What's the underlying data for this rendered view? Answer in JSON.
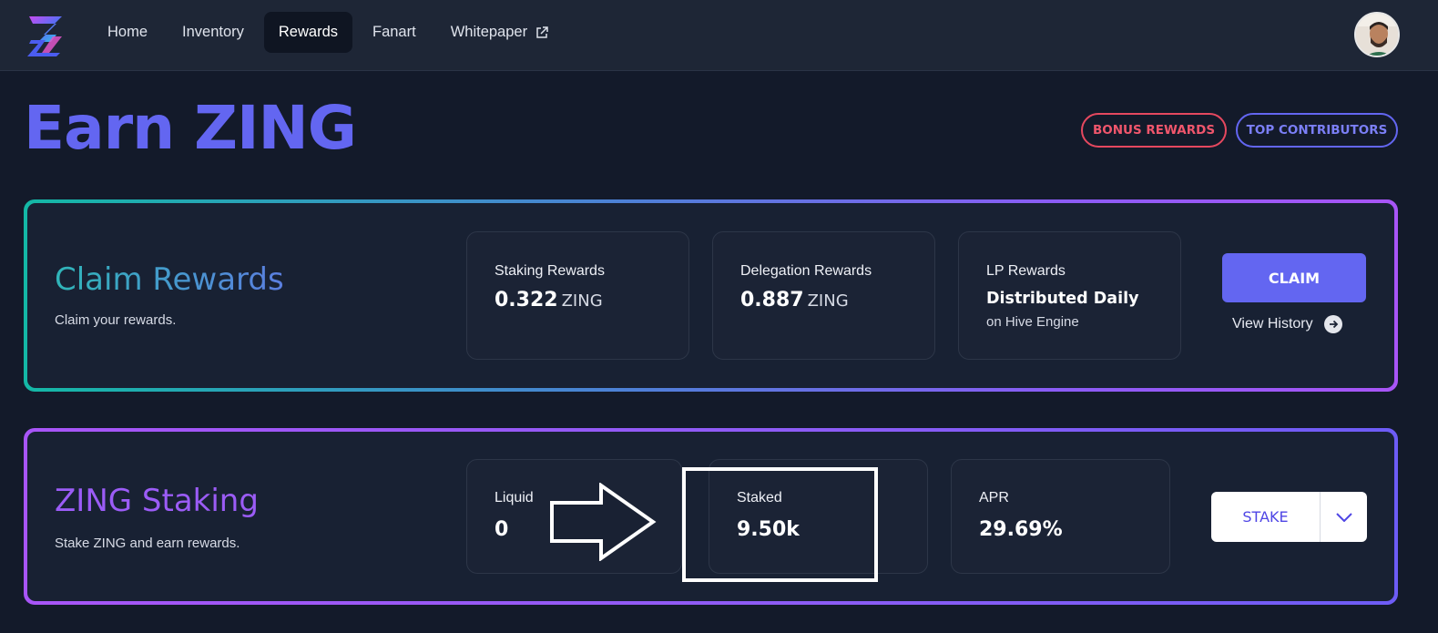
{
  "nav": {
    "items": [
      {
        "label": "Home",
        "active": false
      },
      {
        "label": "Inventory",
        "active": false
      },
      {
        "label": "Rewards",
        "active": true
      },
      {
        "label": "Fanart",
        "active": false
      },
      {
        "label": "Whitepaper",
        "active": false,
        "icon": "external-link-icon"
      }
    ],
    "logo_icon": "zing-logo-icon",
    "avatar_icon": "user-avatar"
  },
  "header": {
    "title": "Earn ZING",
    "bonus_label": "BONUS REWARDS",
    "contributors_label": "TOP CONTRIBUTORS"
  },
  "claim": {
    "title": "Claim Rewards",
    "subtitle": "Claim your rewards.",
    "staking": {
      "label": "Staking Rewards",
      "value": "0.322",
      "unit": "ZING"
    },
    "delegation": {
      "label": "Delegation Rewards",
      "value": "0.887",
      "unit": "ZING"
    },
    "lp": {
      "label": "LP Rewards",
      "value": "Distributed Daily",
      "note": "on Hive Engine"
    },
    "claim_label": "CLAIM",
    "history_label": "View History"
  },
  "staking": {
    "title": "ZING Staking",
    "subtitle": "Stake ZING and earn rewards.",
    "liquid": {
      "label": "Liquid",
      "value": "0"
    },
    "staked": {
      "label": "Staked",
      "value": "9.50k"
    },
    "apr": {
      "label": "APR",
      "value": "29.69%"
    },
    "stake_label": "STAKE"
  },
  "colors": {
    "accent": "#6366f1",
    "bonus": "#e5485f",
    "background": "#131a2a",
    "card": "#1b2335"
  }
}
